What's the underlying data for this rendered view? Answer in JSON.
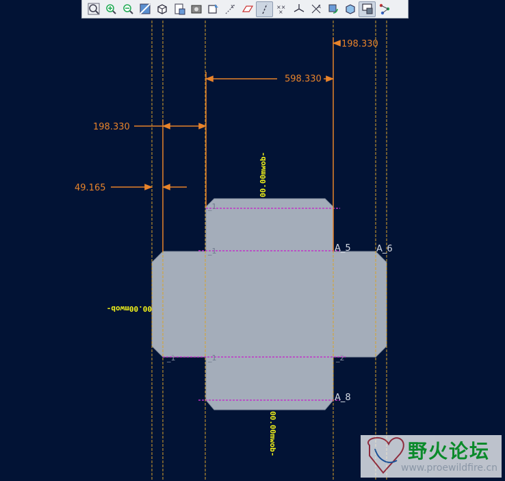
{
  "toolbar": {
    "buttons": [
      {
        "icon": "zoom-fit-icon"
      },
      {
        "icon": "zoom-in-icon"
      },
      {
        "icon": "zoom-out-icon"
      },
      {
        "icon": "repaint-icon"
      },
      {
        "icon": "orient-view-icon"
      },
      {
        "icon": "saved-views-icon"
      },
      {
        "icon": "display-style-icon"
      },
      {
        "icon": "view-manager-icon"
      },
      {
        "icon": "datum-display-icon"
      },
      {
        "icon": "plane-display-icon"
      },
      {
        "icon": "axis-display-icon",
        "active": true
      },
      {
        "icon": "point-display-icon"
      },
      {
        "icon": "csys-display-icon"
      },
      {
        "icon": "annotation-display-icon"
      },
      {
        "icon": "spin-center-icon"
      },
      {
        "icon": "appearance-icon"
      },
      {
        "icon": "dimension-display-icon",
        "active": true
      },
      {
        "icon": "connection-icon"
      }
    ]
  },
  "dimensions": {
    "top_right": "198.330",
    "top_span": "598.330",
    "left_mid": "198.330",
    "left_small": "49.165"
  },
  "bend_labels": {
    "a5": "A_5",
    "a6": "A_6",
    "a8": "A_8",
    "l1": "_1",
    "l2": "_2",
    "l3": "_1",
    "l4": "_1",
    "l5": "_1"
  },
  "bend_notes": {
    "top": "00.00mwob-",
    "left": "00.00mwob-",
    "bottom": "00.00mwob-"
  },
  "watermark": {
    "title": "野火论坛",
    "url": "www.proewildfire.cn"
  },
  "colors": {
    "background": "#021335",
    "sheet": "#a4adba",
    "dim": "#e8832a",
    "bend_line": "#c033c8",
    "note": "#f2f21a",
    "label": "#d8dde6"
  }
}
